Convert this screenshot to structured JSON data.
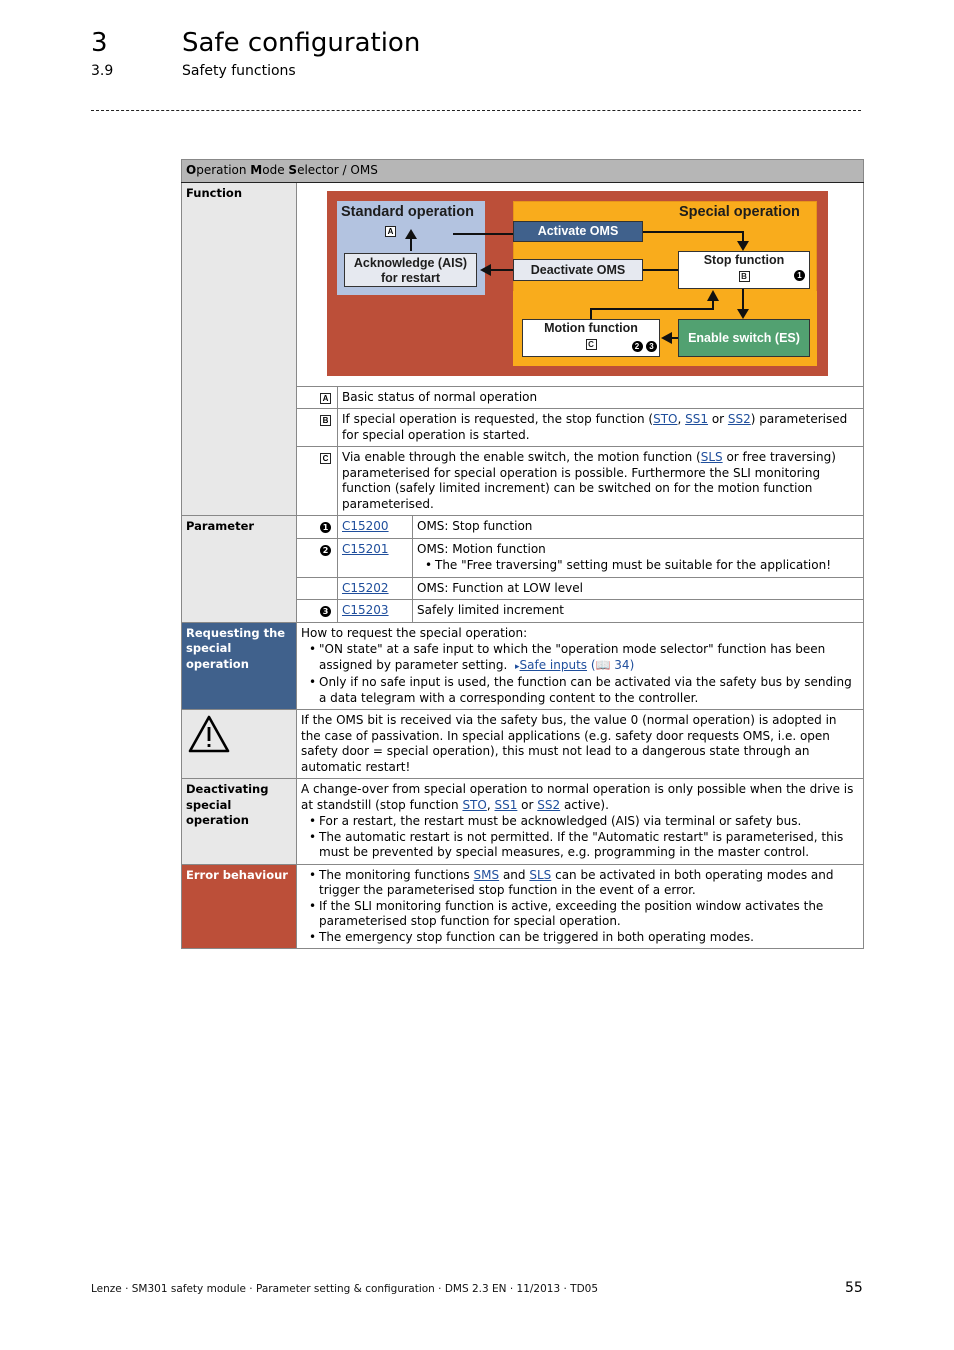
{
  "header": {
    "chapter_number": "3",
    "chapter_title": "Safe configuration",
    "section_number": "3.9",
    "section_title": "Safety functions"
  },
  "table": {
    "title_parts": [
      {
        "bold": "O",
        "rest": "peration "
      },
      {
        "bold": "M",
        "rest": "ode "
      },
      {
        "bold": "S",
        "rest": "elector / OMS"
      }
    ],
    "function_label": "Function",
    "diagram": {
      "standard_title": "Standard operation",
      "special_title": "Special operation",
      "marker_a": "A",
      "marker_b": "B",
      "marker_c": "C",
      "activate": "Activate OMS",
      "deactivate": "Deactivate OMS",
      "ack_line1": "Acknowledge (AIS)",
      "ack_line2": "for restart",
      "stop": "Stop function",
      "motion": "Motion function",
      "enable_switch": "Enable switch (ES)",
      "circ1": "1",
      "circ2": "2",
      "circ3": "3",
      "colors": {
        "outer": "#bc4f39",
        "standard": "#b3c3e0",
        "special": "#f9ac1c",
        "activate": "#40618c",
        "enable_switch": "#52a171"
      }
    },
    "legend": [
      {
        "marker": "A",
        "text": "Basic status of normal operation"
      },
      {
        "marker": "B",
        "pre": "If special operation is requested, the stop function (",
        "links": [
          "STO",
          "SS1",
          "SS2"
        ],
        "sep1": ", ",
        "sep2": " or ",
        "post": ") parameterised for special operation is started."
      },
      {
        "marker": "C",
        "pre": "Via enable through the enable switch, the motion function (",
        "link": "SLS",
        "post": " or free traversing) parameterised for special operation is possible. Furthermore the SLI monitoring function (safely limited increment) can be switched on for the motion function parameterised."
      }
    ],
    "parameter_label": "Parameter",
    "parameters": [
      {
        "marker": "1",
        "code": "C15200",
        "desc": "OMS: Stop function"
      },
      {
        "marker": "2",
        "code": "C15201",
        "desc": "OMS: Motion function",
        "note": "The \"Free traversing\" setting must be suitable for the application!"
      },
      {
        "marker": "",
        "code": "C15202",
        "desc": "OMS: Function at LOW level"
      },
      {
        "marker": "3",
        "code": "C15203",
        "desc": "Safely limited increment"
      }
    ],
    "requesting": {
      "label": "Requesting the special operation",
      "intro": "How to request the special operation:",
      "bullet1": "\"ON state\" at a safe input to which the \"operation mode selector\" function has been assigned by parameter setting.",
      "link_arrow": "▸",
      "link_text": "Safe inputs",
      "page_ref": "(📖 34)",
      "bullet2": "Only if no safe input is used, the function can be activated via the safety bus by sending a data telegram with a corresponding content to the controller."
    },
    "warning": {
      "icon": "warning-triangle-icon",
      "text": "If the OMS bit is received via the safety bus, the value 0 (normal operation) is adopted in the case of passivation. In special applications (e.g. safety door requests OMS, i.e. open safety door = special operation), this must not lead to a dangerous state through an automatic restart!"
    },
    "deactivating": {
      "label": "Deactivating special operation",
      "intro_pre": "A change-over from special operation to normal operation is only possible when the drive is at standstill (stop function ",
      "links": [
        "STO",
        "SS1",
        "SS2"
      ],
      "sep1": ", ",
      "sep2": " or ",
      "intro_post": " active).",
      "bullet1": "For a restart, the restart must be acknowledged (AIS) via terminal or safety bus.",
      "bullet2": "The automatic restart is not permitted. If the \"Automatic restart\" is parameterised, this must be prevented by special measures, e.g. programming in the master control."
    },
    "error": {
      "label": "Error behaviour",
      "b1_pre": "The monitoring functions ",
      "b1_link1": "SMS",
      "b1_mid": " and ",
      "b1_link2": "SLS",
      "b1_post": " can be activated in both operating modes and trigger the parameterised stop function in the event of a error.",
      "bullet2": "If the SLI monitoring function is active, exceeding the position window activates the parameterised stop function for special operation.",
      "bullet3": "The emergency stop function can be triggered in both operating modes."
    }
  },
  "footer": {
    "text": "Lenze · SM301 safety module · Parameter setting & configuration · DMS 2.3 EN · 11/2013 · TD05",
    "page_number": "55"
  }
}
